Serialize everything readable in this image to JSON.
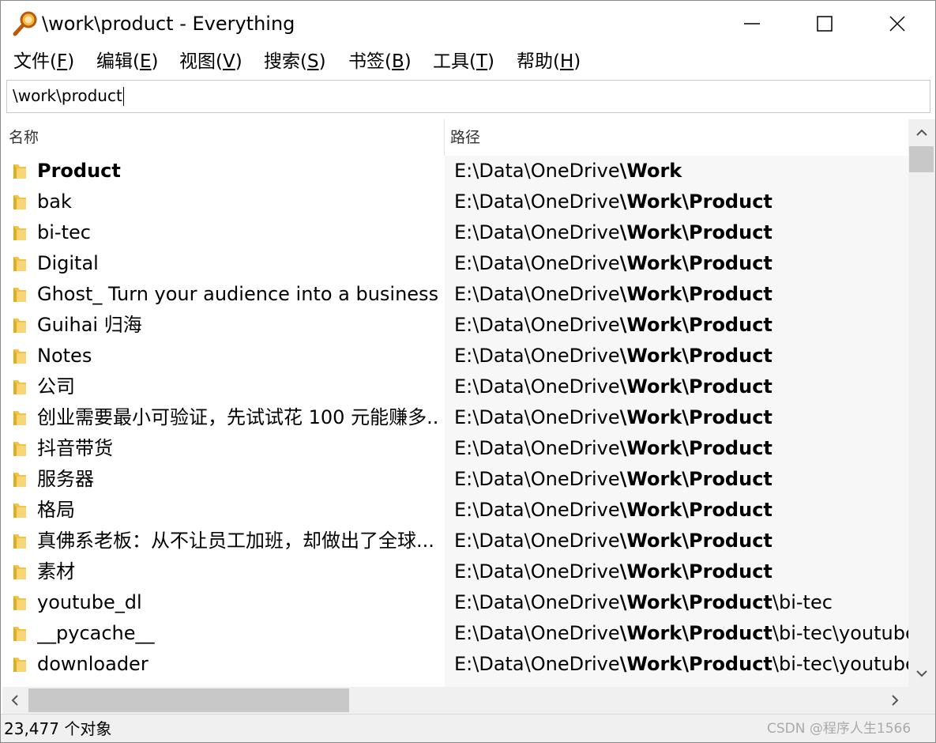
{
  "window": {
    "title": "\\work\\product - Everything"
  },
  "menu": [
    {
      "label": "文件(",
      "key": "F",
      "close": ")"
    },
    {
      "label": "编辑(",
      "key": "E",
      "close": ")"
    },
    {
      "label": "视图(",
      "key": "V",
      "close": ")"
    },
    {
      "label": "搜索(",
      "key": "S",
      "close": ")"
    },
    {
      "label": "书签(",
      "key": "B",
      "close": ")"
    },
    {
      "label": "工具(",
      "key": "T",
      "close": ")"
    },
    {
      "label": "帮助(",
      "key": "H",
      "close": ")"
    }
  ],
  "search": {
    "value": "\\work\\product"
  },
  "columns": {
    "name": "名称",
    "path": "路径"
  },
  "rows": [
    {
      "name": "Product",
      "path_prefix": "E:\\Data\\OneDrive",
      "path_bold": "\\Work",
      "path_suffix": ""
    },
    {
      "name": "bak",
      "path_prefix": "E:\\Data\\OneDrive",
      "path_bold": "\\Work\\Product",
      "path_suffix": ""
    },
    {
      "name": "bi-tec",
      "path_prefix": "E:\\Data\\OneDrive",
      "path_bold": "\\Work\\Product",
      "path_suffix": ""
    },
    {
      "name": "Digital",
      "path_prefix": "E:\\Data\\OneDrive",
      "path_bold": "\\Work\\Product",
      "path_suffix": ""
    },
    {
      "name": "Ghost_ Turn your audience into a business...",
      "path_prefix": "E:\\Data\\OneDrive",
      "path_bold": "\\Work\\Product",
      "path_suffix": ""
    },
    {
      "name": "Guihai 归海",
      "path_prefix": "E:\\Data\\OneDrive",
      "path_bold": "\\Work\\Product",
      "path_suffix": ""
    },
    {
      "name": "Notes",
      "path_prefix": "E:\\Data\\OneDrive",
      "path_bold": "\\Work\\Product",
      "path_suffix": ""
    },
    {
      "name": "公司",
      "path_prefix": "E:\\Data\\OneDrive",
      "path_bold": "\\Work\\Product",
      "path_suffix": ""
    },
    {
      "name": "创业需要最小可验证，先试试花 100 元能赚多...",
      "path_prefix": "E:\\Data\\OneDrive",
      "path_bold": "\\Work\\Product",
      "path_suffix": ""
    },
    {
      "name": "抖音带货",
      "path_prefix": "E:\\Data\\OneDrive",
      "path_bold": "\\Work\\Product",
      "path_suffix": ""
    },
    {
      "name": "服务器",
      "path_prefix": "E:\\Data\\OneDrive",
      "path_bold": "\\Work\\Product",
      "path_suffix": ""
    },
    {
      "name": "格局",
      "path_prefix": "E:\\Data\\OneDrive",
      "path_bold": "\\Work\\Product",
      "path_suffix": ""
    },
    {
      "name": "真佛系老板：从不让员工加班，却做出了全球...",
      "path_prefix": "E:\\Data\\OneDrive",
      "path_bold": "\\Work\\Product",
      "path_suffix": ""
    },
    {
      "name": "素材",
      "path_prefix": "E:\\Data\\OneDrive",
      "path_bold": "\\Work\\Product",
      "path_suffix": ""
    },
    {
      "name": "youtube_dl",
      "path_prefix": "E:\\Data\\OneDrive",
      "path_bold": "\\Work\\Product",
      "path_suffix": "\\bi-tec"
    },
    {
      "name": "__pycache__",
      "path_prefix": "E:\\Data\\OneDrive",
      "path_bold": "\\Work\\Product",
      "path_suffix": "\\bi-tec\\youtube_"
    },
    {
      "name": "downloader",
      "path_prefix": "E:\\Data\\OneDrive",
      "path_bold": "\\Work\\Product",
      "path_suffix": "\\bi-tec\\youtube_"
    }
  ],
  "status": {
    "count": "23,477 个对象",
    "watermark": "CSDN @程序人生1566"
  },
  "icons": {
    "app": "magnifier-icon",
    "folder": "folder-icon",
    "folder_color": "#f5c242"
  }
}
